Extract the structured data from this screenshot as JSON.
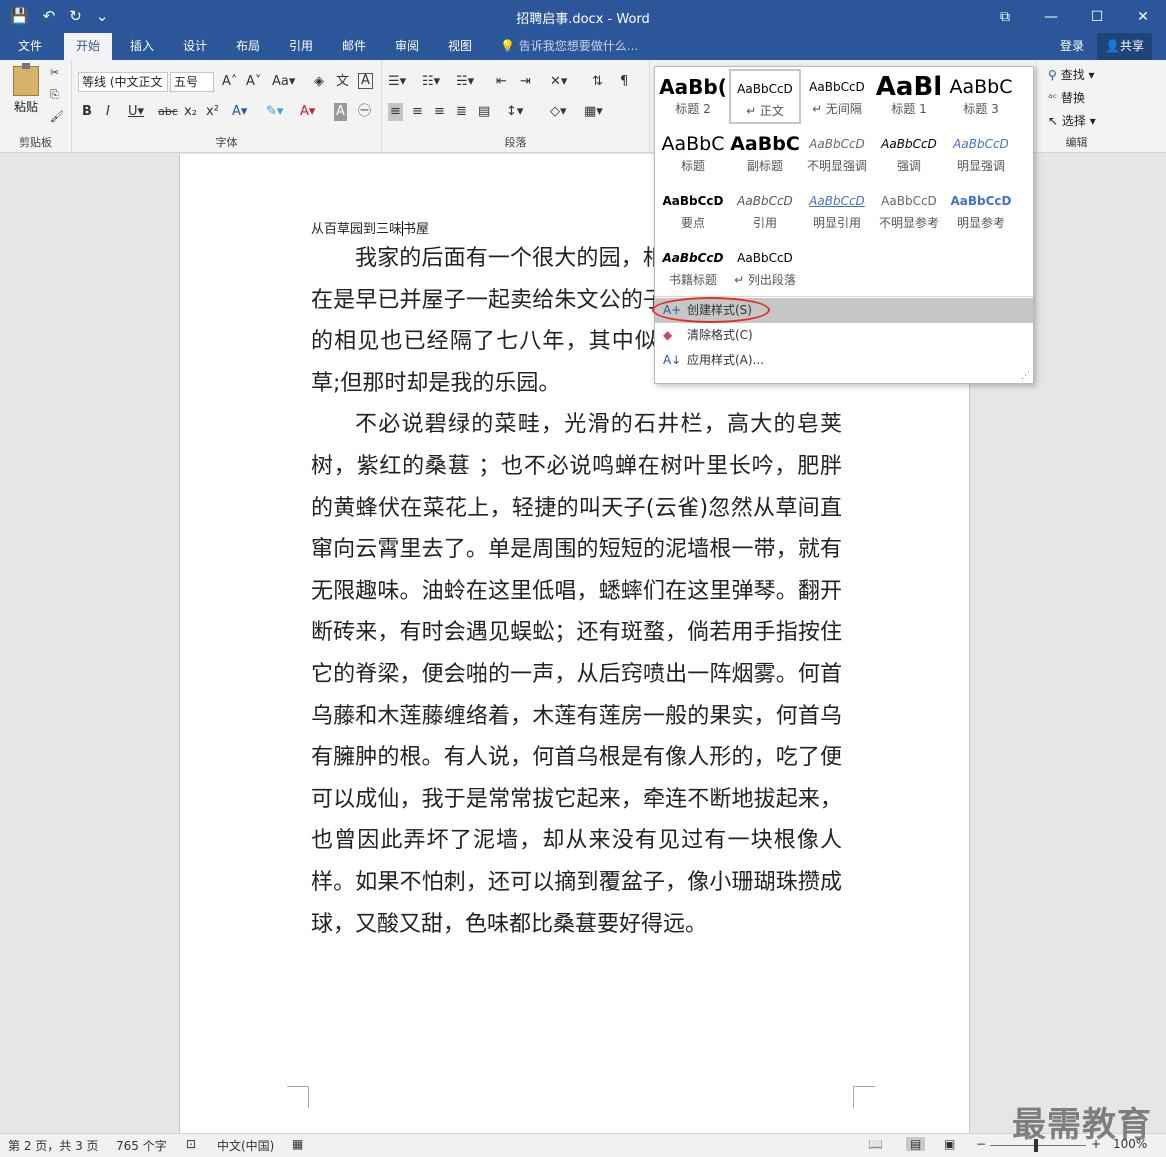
{
  "window": {
    "title": "招聘启事.docx - Word"
  },
  "qat": {
    "save": "💾",
    "undo": "↶",
    "redo": "↻",
    "more": "⌄"
  },
  "tabs": [
    "文件",
    "开始",
    "插入",
    "设计",
    "布局",
    "引用",
    "邮件",
    "审阅",
    "视图"
  ],
  "tell_me": "告诉我您想要做什么...",
  "account": {
    "login": "登录",
    "share": "共享"
  },
  "ribbon": {
    "clipboard": {
      "paste": "粘贴",
      "label": "剪贴板"
    },
    "font": {
      "name": "等线 (中文正文",
      "size": "五号",
      "label": "字体"
    },
    "paragraph": {
      "label": "段落"
    },
    "editing": {
      "find": "查找",
      "replace": "替换",
      "select": "选择",
      "label": "编辑"
    }
  },
  "styles_gallery": {
    "items": [
      {
        "preview": "AaBb(",
        "name": "标题 2"
      },
      {
        "preview": "AaBbCcD",
        "name": "↵ 正文"
      },
      {
        "preview": "AaBbCcD",
        "name": "↵ 无间隔"
      },
      {
        "preview": "AaBl",
        "name": "标题 1"
      },
      {
        "preview": "AaBbC",
        "name": "标题 3"
      },
      {
        "preview": "AaBbC",
        "name": "标题"
      },
      {
        "preview": "AaBbC",
        "name": "副标题"
      },
      {
        "preview": "AaBbCcD",
        "name": "不明显强调"
      },
      {
        "preview": "AaBbCcD",
        "name": "强调"
      },
      {
        "preview": "AaBbCcD",
        "name": "明显强调"
      },
      {
        "preview": "AaBbCcD",
        "name": "要点"
      },
      {
        "preview": "AaBbCcD",
        "name": "引用"
      },
      {
        "preview": "AaBbCcD",
        "name": "明显引用"
      },
      {
        "preview": "AaBbCcD",
        "name": "不明显参考"
      },
      {
        "preview": "AaBbCcD",
        "name": "明显参考"
      },
      {
        "preview": "AaBbCcD",
        "name": "书籍标题"
      },
      {
        "preview": "AaBbCcD",
        "name": "↵ 列出段落"
      }
    ],
    "menu": {
      "create": "创建样式(S)",
      "clear": "清除格式(C)",
      "apply": "应用样式(A)..."
    }
  },
  "document": {
    "title_before": "从百草园到三味",
    "title_after": "书屋",
    "paragraphs": [
      "我家的后面有一个很大的园，相传叫作百草园。现在是早已并屋子一起卖给朱文公的子孙了，连那最末次的相见也已经隔了七八年，其中似乎确凿只有一些野草;但那时却是我的乐园。",
      "不必说碧绿的菜畦，光滑的石井栏，高大的皂荚树，紫红的桑葚 ；也不必说鸣蝉在树叶里长吟，肥胖的黄蜂伏在菜花上，轻捷的叫天子(云雀)忽然从草间直窜向云霄里去了。单是周围的短短的泥墙根一带，就有无限趣味。油蛉在这里低唱，蟋蟀们在这里弹琴。翻开断砖来，有时会遇见蜈蚣；还有斑蝥，倘若用手指按住它的脊梁，便会啪的一声，从后窍喷出一阵烟雾。何首乌藤和木莲藤缠络着，木莲有莲房一般的果实，何首乌有臃肿的根。有人说，何首乌根是有像人形的，吃了便可以成仙，我于是常常拔它起来，牵连不断地拔起来，也曾因此弄坏了泥墙，却从来没有见过有一块根像人样。如果不怕刺，还可以摘到覆盆子，像小珊瑚珠攒成球，又酸又甜，色味都比桑葚要好得远。"
    ]
  },
  "status": {
    "page": "第 2 页，共 3 页",
    "words": "765 个字",
    "language": "中文(中国)",
    "zoom": "100%",
    "zoom_minus": "−",
    "zoom_plus": "+"
  },
  "watermark": "最需教育",
  "colors": {
    "brand": "#2b579a",
    "highlight_circle": "#e0302a"
  }
}
